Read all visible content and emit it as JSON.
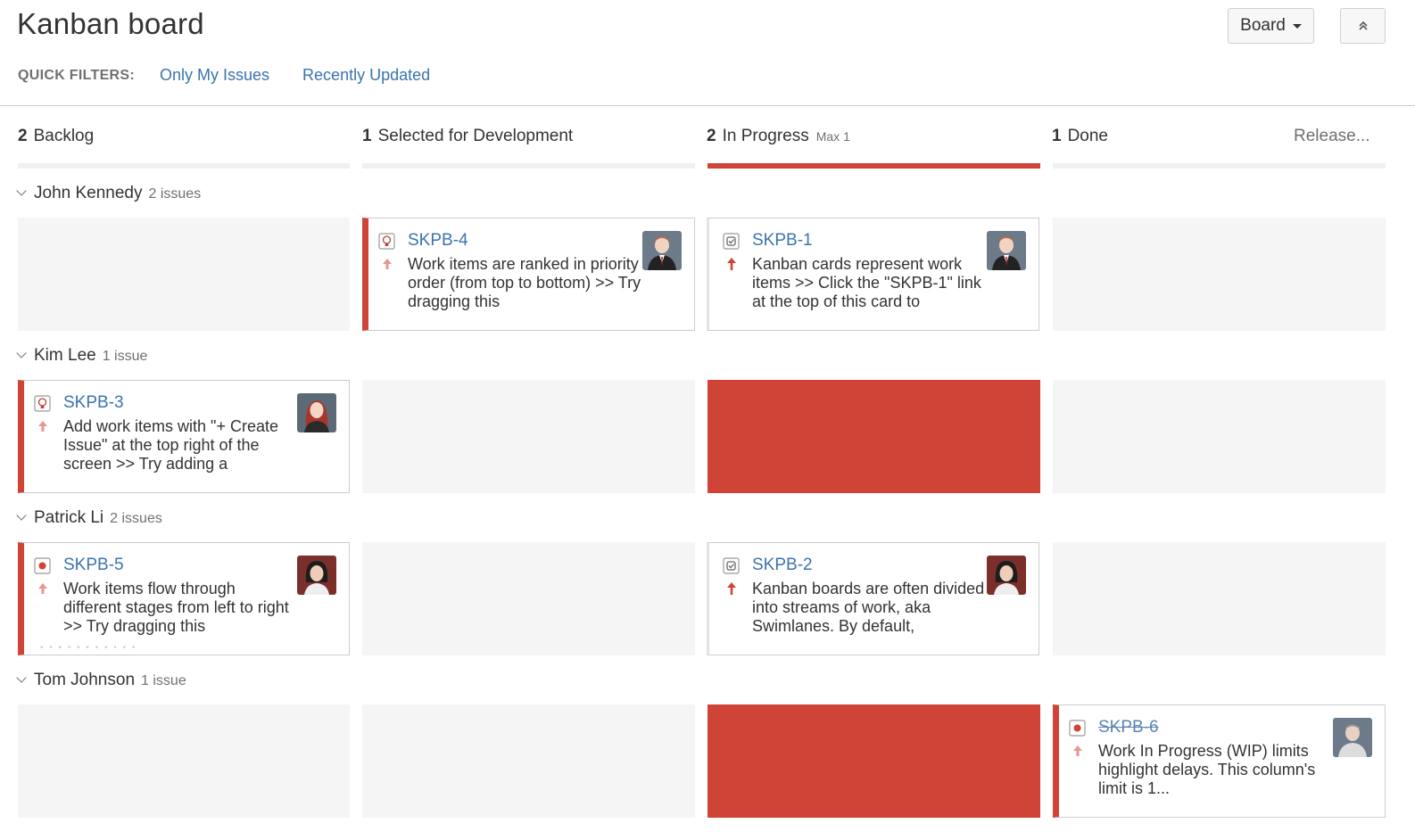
{
  "header": {
    "title": "Kanban board",
    "board_button_label": "Board",
    "collapse_icon": "double-chevron-up-icon"
  },
  "quick_filters": {
    "label": "QUICK FILTERS:",
    "items": [
      "Only My Issues",
      "Recently Updated"
    ]
  },
  "columns": [
    {
      "count": "2",
      "name": "Backlog",
      "max": "",
      "over_limit": false
    },
    {
      "count": "1",
      "name": "Selected for Development",
      "max": "",
      "over_limit": false
    },
    {
      "count": "2",
      "name": "In Progress",
      "max": "Max 1",
      "over_limit": true
    },
    {
      "count": "1",
      "name": "Done",
      "max": "",
      "over_limit": false
    }
  ],
  "release_link": "Release...",
  "colors": {
    "accent_red": "#d04437",
    "link_blue": "#3b73af",
    "cell_grey": "#f5f5f5"
  },
  "swimlanes": [
    {
      "name": "John Kennedy",
      "issue_count": "2 issues",
      "cards": {
        "skpb4": {
          "key": "SKPB-4",
          "summary": "Work items are ranked in priority order (from top to bottom) >> Try dragging this",
          "type_icon": "story-icon",
          "priority_icon": "priority-arrow-up-icon",
          "avatar": "avatar-john-kennedy"
        },
        "skpb1": {
          "key": "SKPB-1",
          "summary": "Kanban cards represent work items >> Click the \"SKPB-1\" link at the top of this card to",
          "type_icon": "task-icon",
          "priority_icon": "priority-arrow-up-icon",
          "avatar": "avatar-john-kennedy"
        }
      }
    },
    {
      "name": "Kim Lee",
      "issue_count": "1 issue",
      "cards": {
        "skpb3": {
          "key": "SKPB-3",
          "summary": "Add work items with \"+ Create Issue\" at the top right of the screen >> Try adding a",
          "type_icon": "story-icon",
          "priority_icon": "priority-arrow-up-icon",
          "avatar": "avatar-kim-lee"
        }
      }
    },
    {
      "name": "Patrick Li",
      "issue_count": "2 issues",
      "cards": {
        "skpb5": {
          "key": "SKPB-5",
          "summary": "Work items flow through different stages from left to right >> Try dragging this",
          "type_icon": "bug-icon",
          "priority_icon": "priority-arrow-up-icon",
          "avatar": "avatar-patrick-li"
        },
        "skpb2": {
          "key": "SKPB-2",
          "summary": "Kanban boards are often divided into streams of work, aka Swimlanes. By default,",
          "type_icon": "task-icon",
          "priority_icon": "priority-arrow-up-icon",
          "avatar": "avatar-patrick-li"
        }
      }
    },
    {
      "name": "Tom Johnson",
      "issue_count": "1 issue",
      "cards": {
        "skpb6": {
          "key": "SKPB-6",
          "summary": "Work In Progress (WIP) limits highlight delays. This column's limit is 1...",
          "type_icon": "bug-icon",
          "priority_icon": "priority-arrow-up-icon",
          "avatar": "avatar-tom-johnson"
        }
      }
    }
  ]
}
